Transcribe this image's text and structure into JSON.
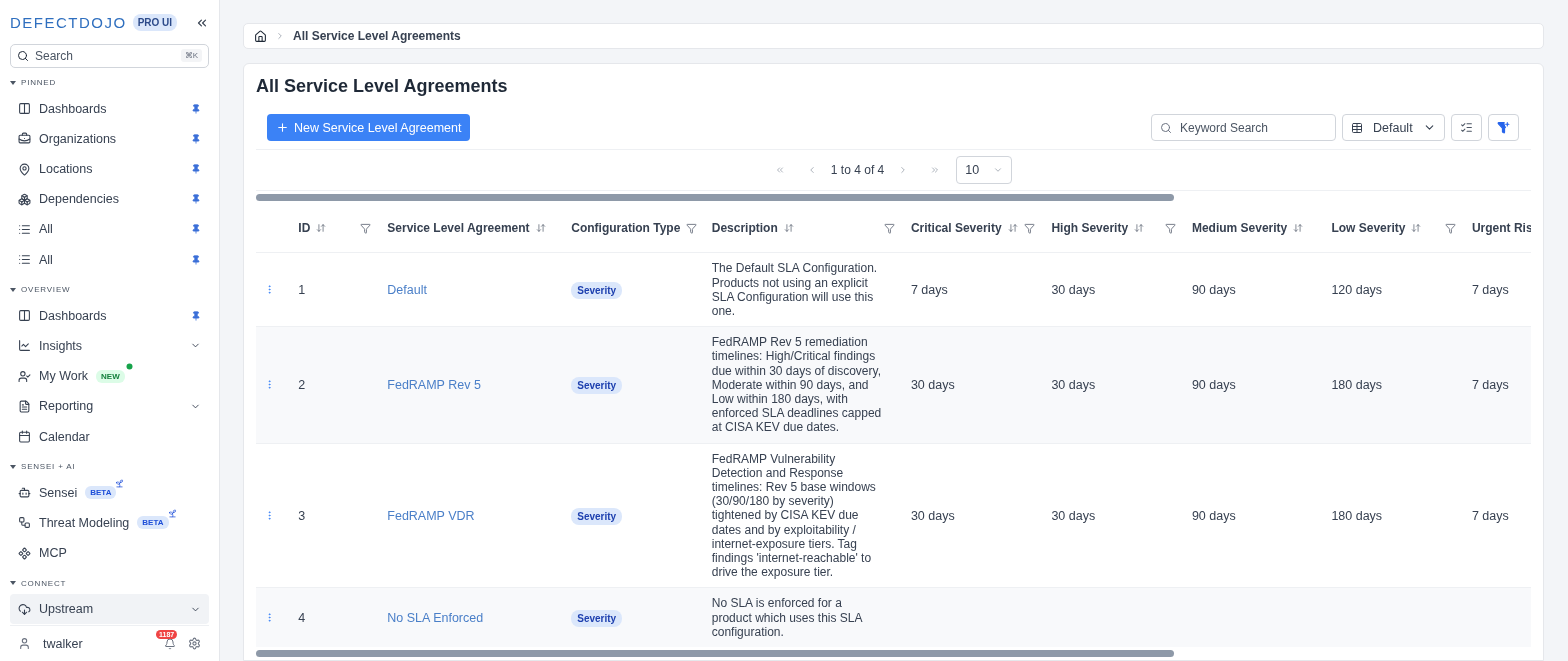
{
  "sidebar": {
    "logo": "DEFECTDOJO",
    "edition_badge": "PRO UI",
    "search": {
      "placeholder": "Search",
      "shortcut": "⌘K"
    },
    "sections": [
      {
        "title": "PINNED",
        "items": [
          {
            "label": "Dashboards",
            "pinned": true,
            "expandable": false,
            "selected": false
          },
          {
            "label": "Organizations",
            "pinned": true,
            "expandable": false,
            "selected": false
          },
          {
            "label": "Locations",
            "pinned": true,
            "expandable": false,
            "selected": false
          },
          {
            "label": "Dependencies",
            "pinned": true,
            "expandable": false,
            "selected": false
          },
          {
            "label": "All",
            "pinned": true,
            "expandable": false,
            "selected": false
          },
          {
            "label": "All",
            "pinned": true,
            "expandable": false,
            "selected": false
          }
        ]
      },
      {
        "title": "OVERVIEW",
        "items": [
          {
            "label": "Dashboards",
            "pinned": true,
            "expandable": false,
            "selected": false
          },
          {
            "label": "Insights",
            "pinned": false,
            "expandable": true,
            "selected": false
          },
          {
            "label": "My Work",
            "pinned": false,
            "expandable": false,
            "selected": false,
            "badge": {
              "text": "NEW",
              "kind": "new"
            }
          },
          {
            "label": "Reporting",
            "pinned": false,
            "expandable": true,
            "selected": false
          },
          {
            "label": "Calendar",
            "pinned": false,
            "expandable": false,
            "selected": false
          }
        ]
      },
      {
        "title": "SENSEI + AI",
        "items": [
          {
            "label": "Sensei",
            "pinned": false,
            "expandable": false,
            "selected": false,
            "badge": {
              "text": "BETA",
              "kind": "beta"
            }
          },
          {
            "label": "Threat Modeling",
            "pinned": false,
            "expandable": false,
            "selected": false,
            "badge": {
              "text": "BETA",
              "kind": "beta"
            }
          },
          {
            "label": "MCP",
            "pinned": false,
            "expandable": false,
            "selected": false
          }
        ]
      },
      {
        "title": "CONNECT",
        "items": [
          {
            "label": "Upstream",
            "pinned": false,
            "expandable": true,
            "selected": true
          }
        ]
      }
    ],
    "user": {
      "name": "twalker",
      "notifications": "1187"
    }
  },
  "breadcrumb": [
    "All Service Level Agreements"
  ],
  "page_title": "All Service Level Agreements",
  "toolbar": {
    "new_button": "New Service Level Agreement",
    "keyword_search": {
      "placeholder": "Keyword Search"
    },
    "view_select": "Default"
  },
  "pagination": {
    "range": "1 to 4 of 4",
    "page_size": "10"
  },
  "table": {
    "columns": [
      {
        "label": "ID",
        "sortable": true,
        "filterable": true
      },
      {
        "label": "Service Level Agreement",
        "sortable": true,
        "filterable": false
      },
      {
        "label": "Configuration Type",
        "sortable": false,
        "filterable": true
      },
      {
        "label": "Description",
        "sortable": true,
        "filterable": true
      },
      {
        "label": "Critical Severity",
        "sortable": true,
        "filterable": true
      },
      {
        "label": "High Severity",
        "sortable": true,
        "filterable": true
      },
      {
        "label": "Medium Severity",
        "sortable": true,
        "filterable": false
      },
      {
        "label": "Low Severity",
        "sortable": true,
        "filterable": true
      },
      {
        "label": "Urgent Ris",
        "sortable": false,
        "filterable": false
      }
    ],
    "rows": [
      {
        "cells": [
          "1",
          "Default",
          "Severity",
          "The Default SLA Configuration. Products not using an explicit SLA Configuration will use this one.",
          "7 days",
          "30 days",
          "90 days",
          "120 days",
          "7 days"
        ]
      },
      {
        "cells": [
          "2",
          "FedRAMP Rev 5",
          "Severity",
          "FedRAMP Rev 5 remediation timelines: High/Critical findings due within 30 days of discovery, Moderate within 90 days, and Low within 180 days, with enforced SLA deadlines capped at CISA KEV due dates.",
          "30 days",
          "30 days",
          "90 days",
          "180 days",
          "7 days"
        ]
      },
      {
        "cells": [
          "3",
          "FedRAMP VDR",
          "Severity",
          "FedRAMP Vulnerability Detection and Response timelines: Rev 5 base windows (30/90/180 by severity) tightened by CISA KEV due dates and by exploitability / internet-exposure tiers. Tag findings 'internet-reachable' to drive the exposure tier.",
          "30 days",
          "30 days",
          "90 days",
          "180 days",
          "7 days"
        ]
      },
      {
        "cells": [
          "4",
          "No SLA Enforced",
          "Severity",
          "No SLA is enforced for a product which uses this SLA configuration."
        ]
      }
    ]
  }
}
